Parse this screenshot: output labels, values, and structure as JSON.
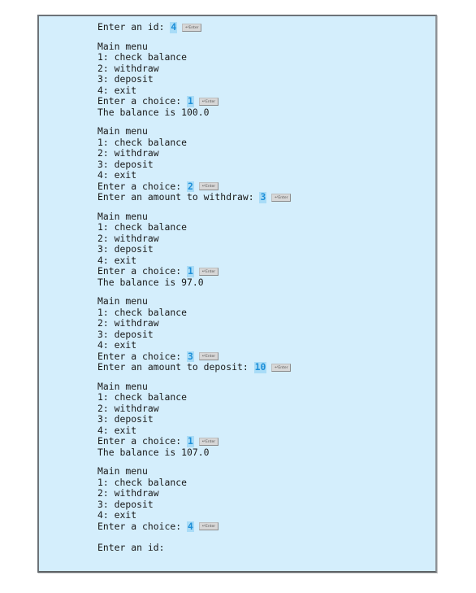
{
  "console": {
    "enter_key_label": "Enter",
    "enter_key_glyph": "↵",
    "colors": {
      "background": "#d4eefc",
      "input_highlight": "#a9dcf7",
      "input_text": "#1e8fd8"
    },
    "blocks": [
      {
        "lines": [
          {
            "text": "Enter an id: ",
            "input": "4"
          }
        ]
      },
      {
        "lines": [
          {
            "text": "Main menu"
          },
          {
            "text": "1: check balance"
          },
          {
            "text": "2: withdraw"
          },
          {
            "text": "3: deposit"
          },
          {
            "text": "4: exit"
          },
          {
            "text": "Enter a choice: ",
            "input": "1"
          },
          {
            "text": "The balance is 100.0"
          }
        ]
      },
      {
        "lines": [
          {
            "text": "Main menu"
          },
          {
            "text": "1: check balance"
          },
          {
            "text": "2: withdraw"
          },
          {
            "text": "3: deposit"
          },
          {
            "text": "4: exit"
          },
          {
            "text": "Enter a choice: ",
            "input": "2"
          },
          {
            "text": "Enter an amount to withdraw: ",
            "input": "3"
          }
        ]
      },
      {
        "lines": [
          {
            "text": "Main menu"
          },
          {
            "text": "1: check balance"
          },
          {
            "text": "2: withdraw"
          },
          {
            "text": "3: deposit"
          },
          {
            "text": "4: exit"
          },
          {
            "text": "Enter a choice: ",
            "input": "1"
          },
          {
            "text": "The balance is 97.0"
          }
        ]
      },
      {
        "lines": [
          {
            "text": "Main menu"
          },
          {
            "text": "1: check balance"
          },
          {
            "text": "2: withdraw"
          },
          {
            "text": "3: deposit"
          },
          {
            "text": "4: exit"
          },
          {
            "text": "Enter a choice: ",
            "input": "3"
          },
          {
            "text": "Enter an amount to deposit: ",
            "input": "10"
          }
        ]
      },
      {
        "lines": [
          {
            "text": "Main menu"
          },
          {
            "text": "1: check balance"
          },
          {
            "text": "2: withdraw"
          },
          {
            "text": "3: deposit"
          },
          {
            "text": "4: exit"
          },
          {
            "text": "Enter a choice: ",
            "input": "1"
          },
          {
            "text": "The balance is 107.0"
          }
        ]
      },
      {
        "lines": [
          {
            "text": "Main menu"
          },
          {
            "text": "1: check balance"
          },
          {
            "text": "2: withdraw"
          },
          {
            "text": "3: deposit"
          },
          {
            "text": "4: exit"
          },
          {
            "text": "Enter a choice: ",
            "input": "4"
          }
        ]
      },
      {
        "lines": [
          {
            "text": "Enter an id:"
          }
        ]
      }
    ]
  }
}
